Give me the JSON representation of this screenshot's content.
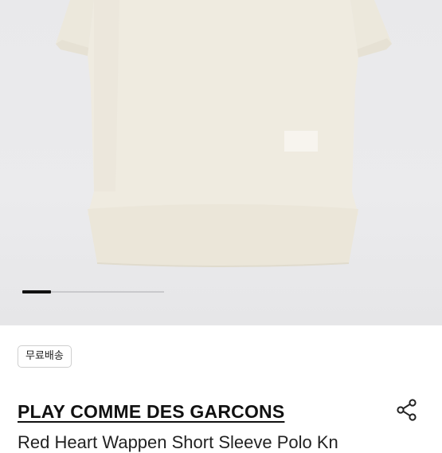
{
  "gallery": {
    "image_alt": "product-photo-knit-polo",
    "slide_progress": 0.2
  },
  "product": {
    "badge_label": "무료배송",
    "brand": "PLAY COMME DES GARCONS",
    "title": "Red Heart Wappen Short Sleeve Polo Kn",
    "share_icon": "share-icon"
  },
  "colors": {
    "garment": "#efebe0",
    "background": "#e9e9eb",
    "indicator_active": "#111111"
  }
}
